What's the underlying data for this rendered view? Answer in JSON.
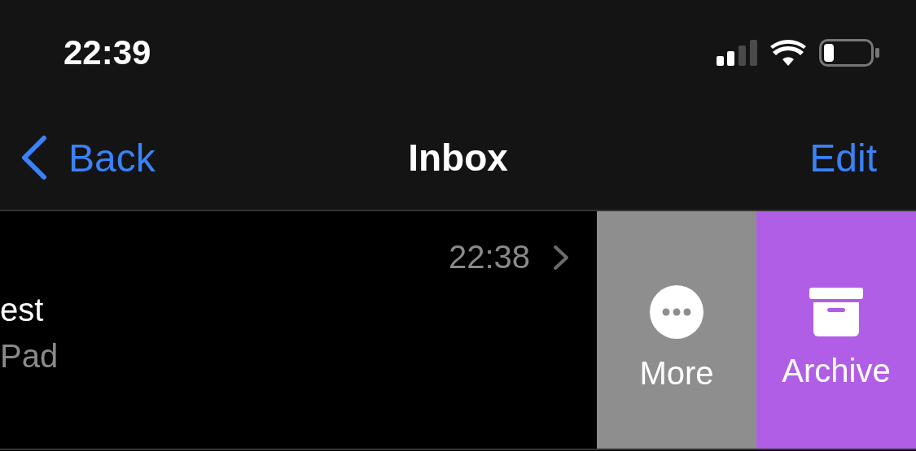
{
  "status_bar": {
    "time": "22:39"
  },
  "nav": {
    "back": "Back",
    "title": "Inbox",
    "edit": "Edit"
  },
  "messages": [
    {
      "time": "22:38",
      "subject": "est",
      "preview": "Pad",
      "actions": [
        {
          "kind": "more",
          "label": "More",
          "color": "#8e8e8e"
        },
        {
          "kind": "archive",
          "label": "Archive",
          "color": "#b15ee6"
        }
      ]
    }
  ]
}
